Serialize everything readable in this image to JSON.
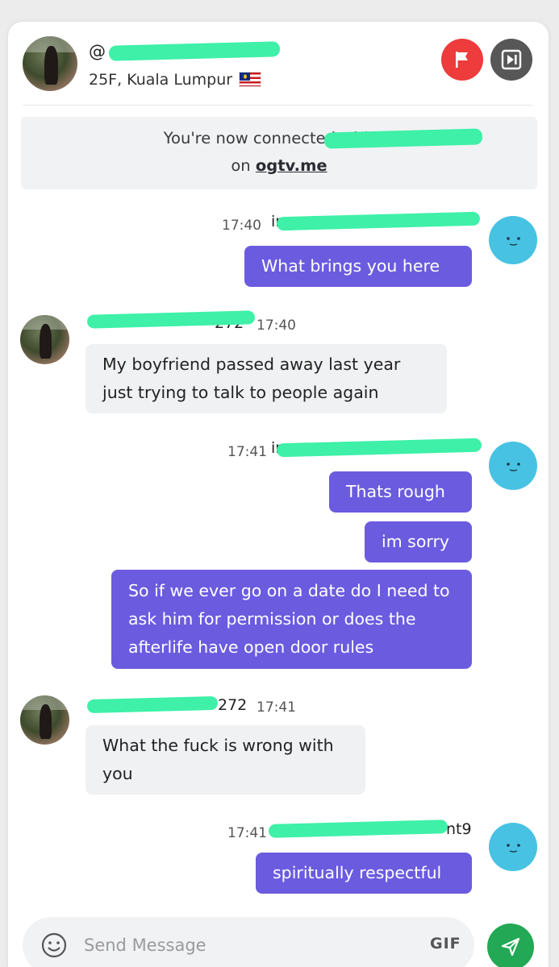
{
  "header": {
    "handle_prefix": "@",
    "subtitle": "25F, Kuala Lumpur",
    "flag_icon": "malaysia-flag-icon",
    "report_icon": "flag-icon",
    "skip_icon": "skip-icon"
  },
  "notice": {
    "prefix": "You're now connected with ",
    "mention": "@",
    "on_text": "on ",
    "site": "ogtv.me"
  },
  "messages": [
    {
      "side": "me",
      "username_visible": "inv",
      "time": "17:40",
      "lines": [
        "What brings you here"
      ]
    },
    {
      "side": "them",
      "username_visible": "272",
      "time": "17:40",
      "lines": [
        "My boyfriend passed away last year",
        "just trying to talk to people again"
      ]
    },
    {
      "side": "me",
      "username_visible": "inv",
      "time": "17:41",
      "lines": [
        "Thats rough",
        "im sorry",
        "So if we ever go on a date do I need to ask him for permission or does the afterlife have open door rules"
      ]
    },
    {
      "side": "them",
      "username_visible": "272",
      "time": "17:41",
      "lines": [
        "What the fuck is wrong with you"
      ]
    },
    {
      "side": "me",
      "username_visible": "nt9",
      "time": "17:41",
      "lines": [
        "spiritually respectful"
      ]
    }
  ],
  "bubbles": {
    "m1": "What brings you here",
    "m2": "My boyfriend passed away last year just trying to talk to people again",
    "m3a": "Thats rough",
    "m3b": "im sorry",
    "m3c": "So if we ever go on a date do I need to ask him for permission or does the afterlife have open door rules",
    "m4": "What the fuck is wrong with you",
    "m5": "spiritually respectful"
  },
  "times": {
    "t1": "17:40",
    "t2": "17:40",
    "t3": "17:41",
    "t4": "17:41",
    "t5": "17:41"
  },
  "names": {
    "n1": "inv",
    "n2": "272",
    "n3": "inv",
    "n4": "272",
    "n5": "nt9"
  },
  "composer": {
    "placeholder": "Send Message",
    "gif_label": "GIF",
    "emoji_icon": "emoji-icon",
    "send_icon": "send-icon"
  },
  "colors": {
    "outgoing_bubble": "#6b5bdf",
    "incoming_bubble": "#f0f1f3",
    "report_button": "#ee3b3b",
    "send_button": "#23a855",
    "redaction": "#3ef0a8",
    "my_avatar": "#48c2e3"
  }
}
